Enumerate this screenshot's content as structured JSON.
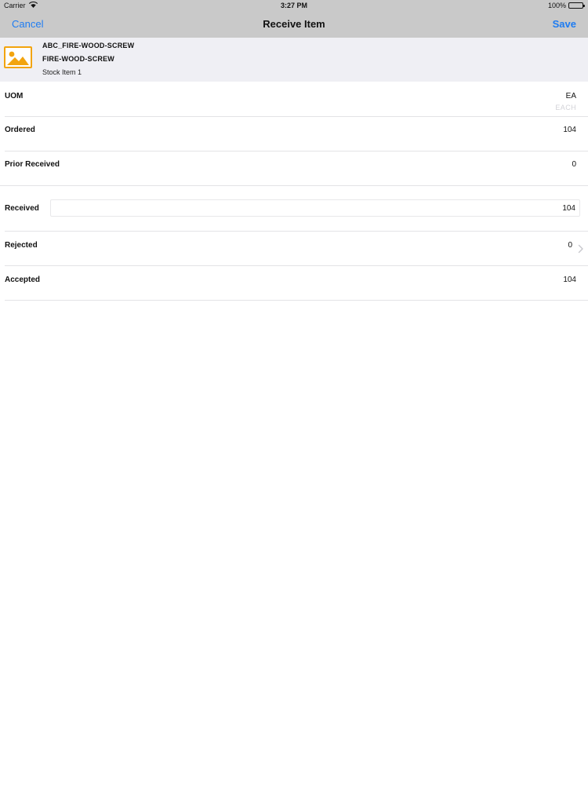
{
  "status_bar": {
    "carrier": "Carrier",
    "time": "3:27 PM",
    "battery": "100%",
    "icons": [
      "wifi-icon",
      "battery-icon"
    ]
  },
  "nav": {
    "cancel_label": "Cancel",
    "title": "Receive Item",
    "save_label": "Save",
    "accent_color": "#1e7cf2"
  },
  "item": {
    "code": "ABC_FIRE-WOOD-SCREW",
    "name": "FIRE-WOOD-SCREW",
    "description": "Stock Item 1",
    "thumbnail_icon": "image-placeholder-icon",
    "thumbnail_color": "#f2a40f"
  },
  "fields": {
    "uom": {
      "label": "UOM",
      "value": "EA",
      "sub": "EACH"
    },
    "ordered": {
      "label": "Ordered",
      "value": "104"
    },
    "prior_received": {
      "label": "Prior Received",
      "value": "0"
    },
    "received": {
      "label": "Received",
      "value": "104"
    },
    "rejected": {
      "label": "Rejected",
      "value": "0",
      "icon": "chevron-right-icon"
    },
    "accepted": {
      "label": "Accepted",
      "value": "104"
    }
  }
}
